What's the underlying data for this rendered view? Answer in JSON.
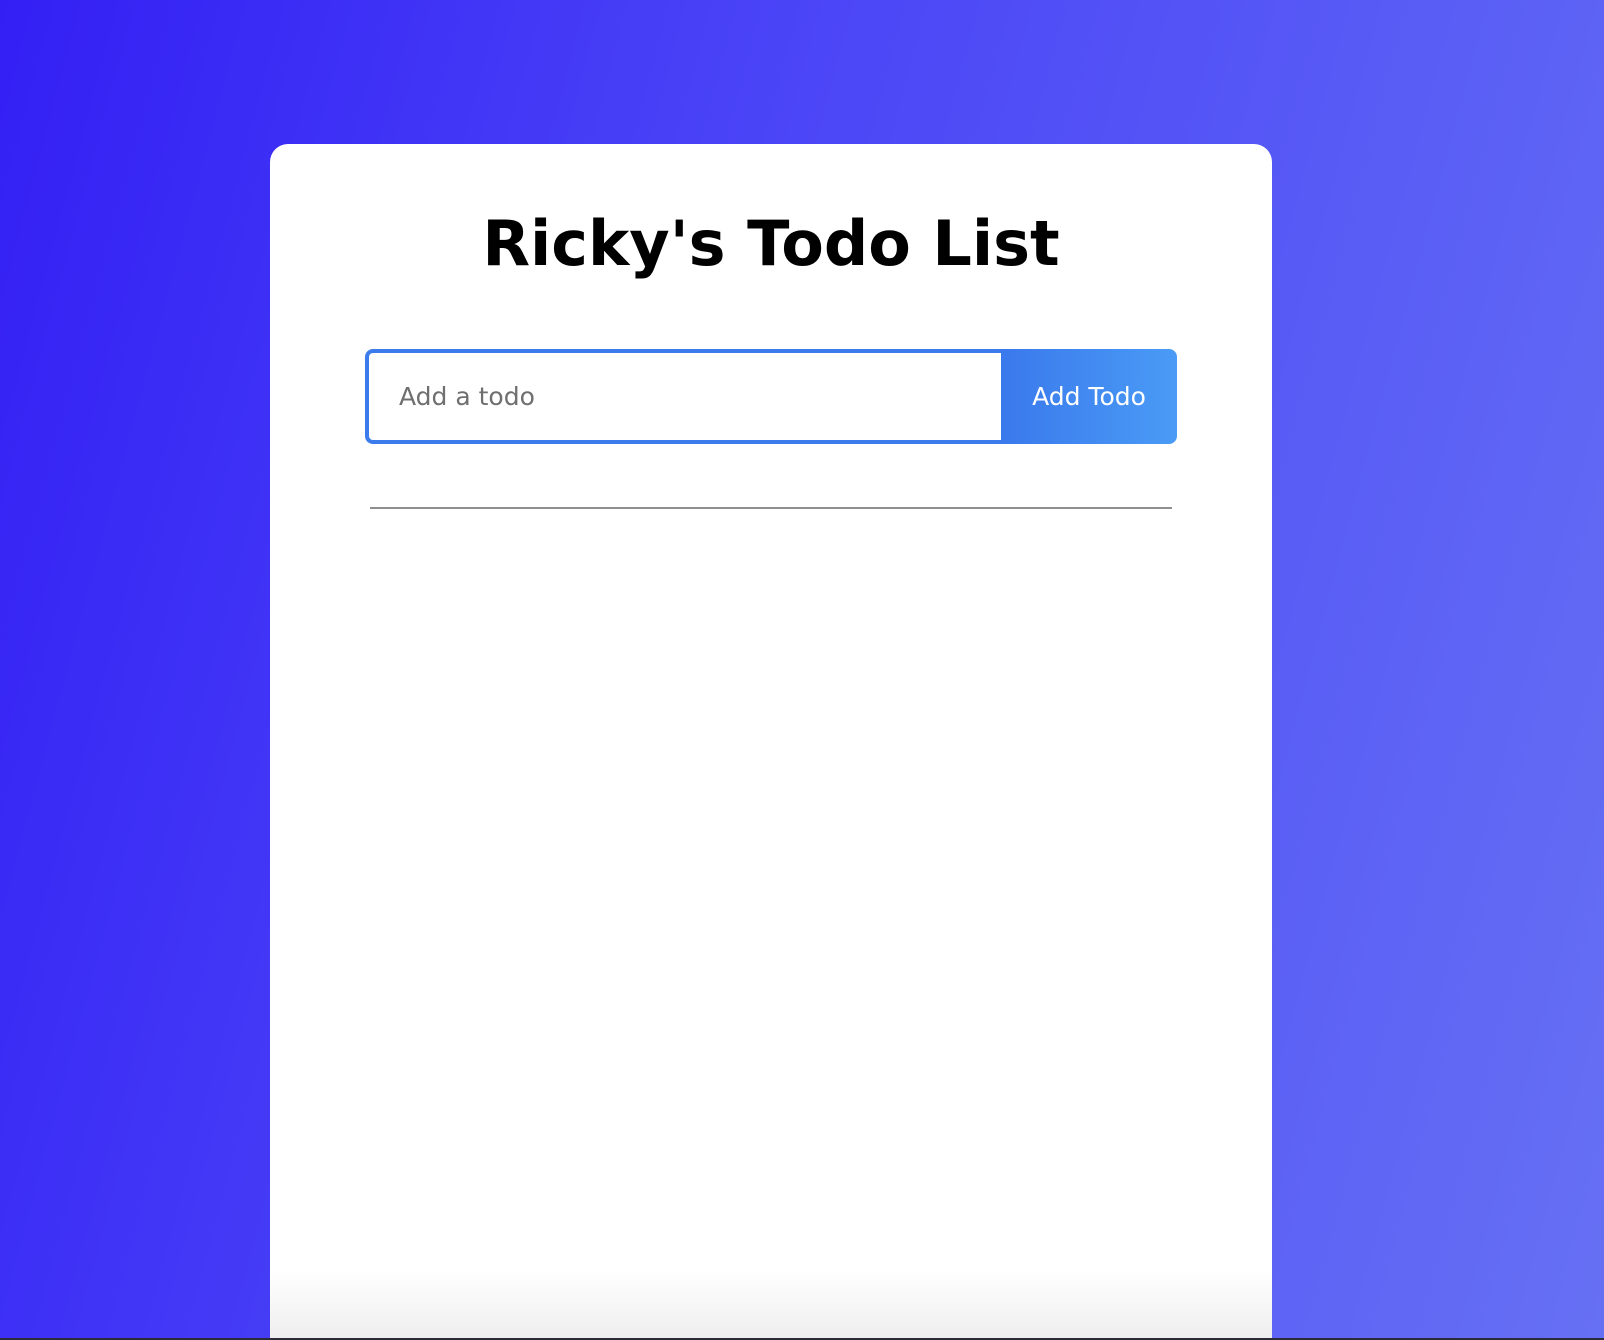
{
  "app": {
    "title": "Ricky's Todo List"
  },
  "form": {
    "input_placeholder": "Add a todo",
    "input_value": "",
    "add_button_label": "Add Todo"
  },
  "todos": [],
  "colors": {
    "background_gradient_start": "#331ff4",
    "background_gradient_end": "#6670f4",
    "accent": "#3b7bec",
    "button_gradient_end": "#4a9bf6"
  }
}
